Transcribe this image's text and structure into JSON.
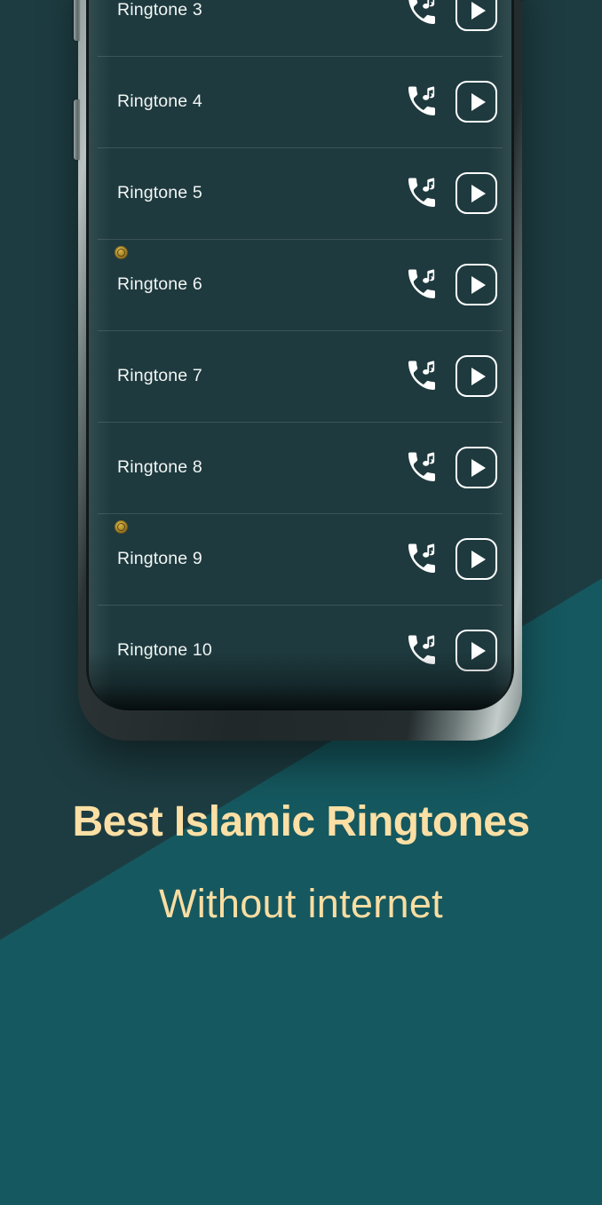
{
  "app": {
    "screen_bg": "#1e3a3e",
    "accent_cream": "#fbdfa4",
    "background_dark_teal": "#1d3c41",
    "background_teal": "#166167"
  },
  "ringtone_list": {
    "rows": [
      {
        "label": "Ringtone 3",
        "badge": false,
        "tone_icon": "phone-music-icon",
        "play_icon": "play-icon"
      },
      {
        "label": "Ringtone 4",
        "badge": false,
        "tone_icon": "phone-music-icon",
        "play_icon": "play-icon"
      },
      {
        "label": "Ringtone 5",
        "badge": false,
        "tone_icon": "phone-music-icon",
        "play_icon": "play-icon"
      },
      {
        "label": "Ringtone 6",
        "badge": true,
        "tone_icon": "phone-music-icon",
        "play_icon": "play-icon"
      },
      {
        "label": "Ringtone 7",
        "badge": false,
        "tone_icon": "phone-music-icon",
        "play_icon": "play-icon"
      },
      {
        "label": "Ringtone 8",
        "badge": false,
        "tone_icon": "phone-music-icon",
        "play_icon": "play-icon"
      },
      {
        "label": "Ringtone 9",
        "badge": true,
        "tone_icon": "phone-music-icon",
        "play_icon": "play-icon"
      },
      {
        "label": "Ringtone 10",
        "badge": false,
        "tone_icon": "phone-music-icon",
        "play_icon": "play-icon"
      }
    ]
  },
  "promo": {
    "title": "Best Islamic Ringtones",
    "subtitle": "Without internet"
  }
}
